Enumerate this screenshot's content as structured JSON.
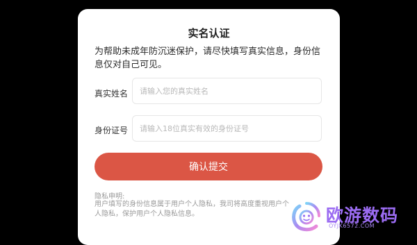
{
  "dialog": {
    "title": "实名认证",
    "intro": "为帮助未成年防沉迷保护，请尽快填写真实信息，身份信息仅对自己可见。",
    "name_field": {
      "label": "真实姓名",
      "placeholder": "请输入您的真实姓名",
      "value": ""
    },
    "id_field": {
      "label": "身份证号",
      "placeholder": "请输入18位真实有效的身份证号",
      "value": ""
    },
    "submit_label": "确认提交",
    "privacy": {
      "title": "隐私申明:",
      "body": "用户填写的身份信息属于用户个人隐私，我司将高度重视用户个人隐私，保护用户个人隐私信息。"
    }
  },
  "watermark": {
    "name": "欧游数码",
    "domain": "OYJK6572.COM"
  },
  "colors": {
    "accent": "#db5645",
    "background": "#000000",
    "watermark": "#9b6cf2"
  }
}
